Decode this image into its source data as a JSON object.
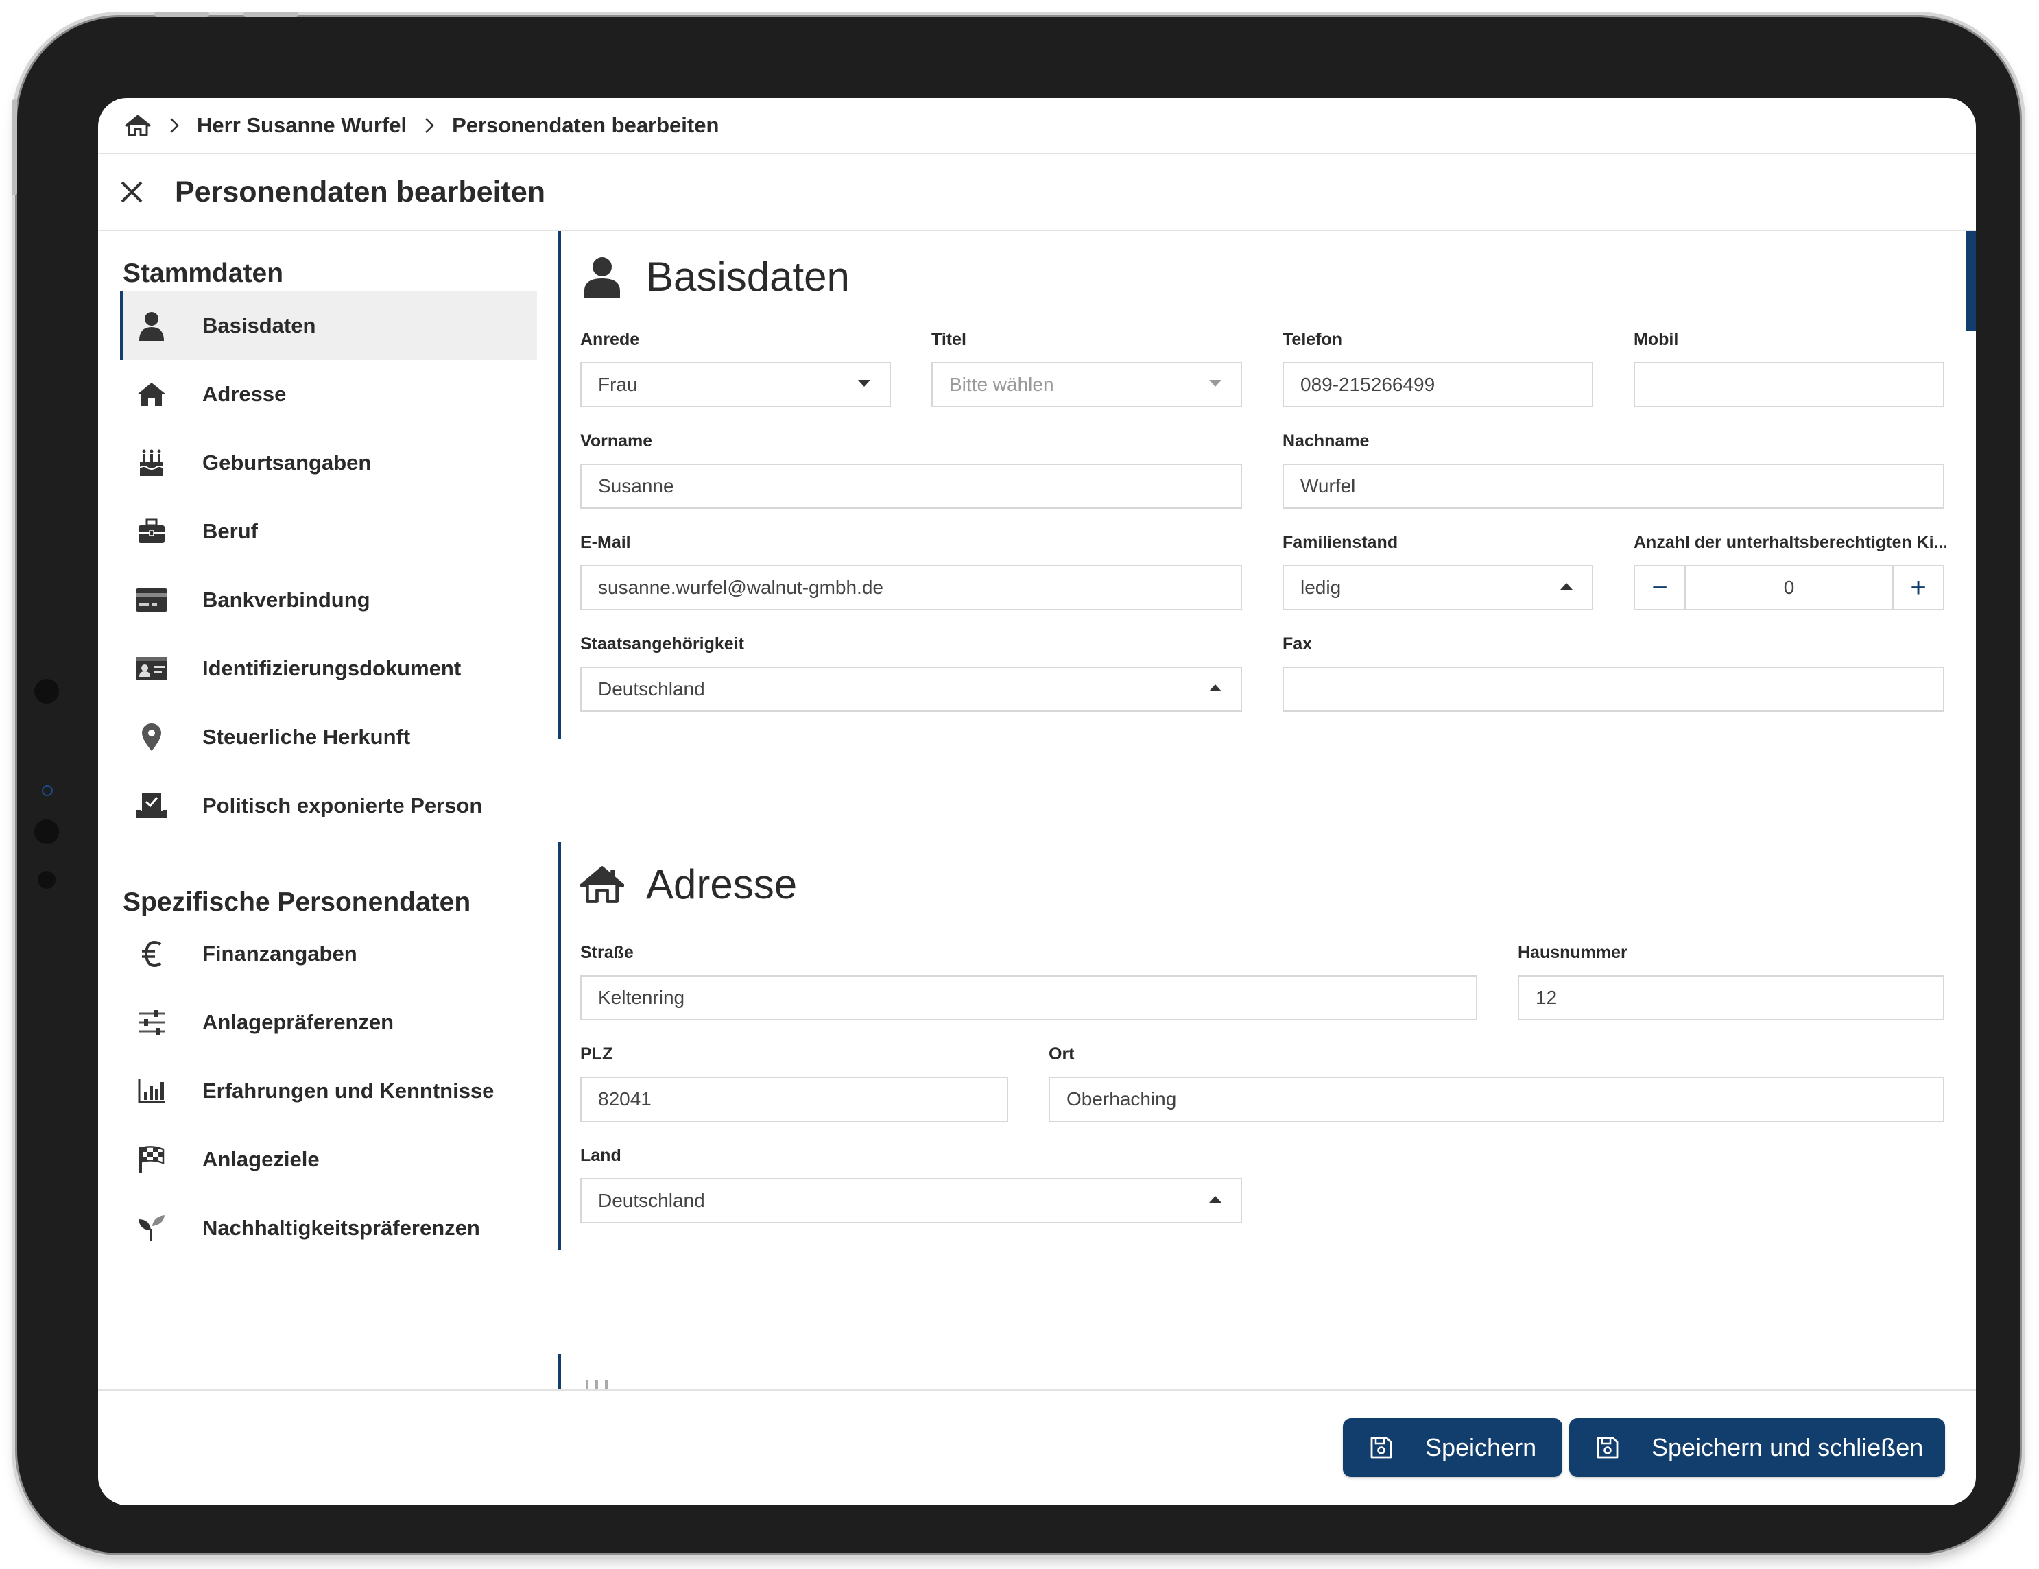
{
  "breadcrumb": {
    "items": [
      "Herr Susanne Wurfel",
      "Personendaten bearbeiten"
    ]
  },
  "page": {
    "title": "Personendaten bearbeiten"
  },
  "sidebar": {
    "groups": [
      {
        "title": "Stammdaten",
        "items": [
          {
            "label": "Basisdaten",
            "icon": "person-icon"
          },
          {
            "label": "Adresse",
            "icon": "home-icon"
          },
          {
            "label": "Geburtsangaben",
            "icon": "birthday-cake-icon"
          },
          {
            "label": "Beruf",
            "icon": "briefcase-icon"
          },
          {
            "label": "Bankverbindung",
            "icon": "credit-card-icon"
          },
          {
            "label": "Identifizierungsdokument",
            "icon": "id-card-icon"
          },
          {
            "label": "Steuerliche Herkunft",
            "icon": "map-pin-icon"
          },
          {
            "label": "Politisch exponierte Person",
            "icon": "ballot-box-icon"
          }
        ]
      },
      {
        "title": "Spezifische Personendaten",
        "items": [
          {
            "label": "Finanzangaben",
            "icon": "euro-icon"
          },
          {
            "label": "Anlagepräferenzen",
            "icon": "sliders-icon"
          },
          {
            "label": "Erfahrungen und Kenntnisse",
            "icon": "bar-chart-icon"
          },
          {
            "label": "Anlageziele",
            "icon": "checkered-flag-icon"
          },
          {
            "label": "Nachhaltigkeitspräferenzen",
            "icon": "seedling-icon"
          }
        ]
      }
    ],
    "active": "Basisdaten"
  },
  "basisdaten": {
    "title": "Basisdaten",
    "anrede": {
      "label": "Anrede",
      "value": "Frau"
    },
    "titel": {
      "label": "Titel",
      "placeholder": "Bitte wählen"
    },
    "telefon": {
      "label": "Telefon",
      "value": "089-215266499"
    },
    "mobil": {
      "label": "Mobil",
      "value": ""
    },
    "vorname": {
      "label": "Vorname",
      "value": "Susanne"
    },
    "nachname": {
      "label": "Nachname",
      "value": "Wurfel"
    },
    "email": {
      "label": "E-Mail",
      "value": "susanne.wurfel@walnut-gmbh.de"
    },
    "familienstand": {
      "label": "Familienstand",
      "value": "ledig"
    },
    "kinder": {
      "label": "Anzahl der unterhaltsberechtigten Ki...",
      "value": "0",
      "minus": "−",
      "plus": "+"
    },
    "staatsangehoerigkeit": {
      "label": "Staatsangehörigkeit",
      "value": "Deutschland"
    },
    "fax": {
      "label": "Fax",
      "value": ""
    }
  },
  "adresse": {
    "title": "Adresse",
    "strasse": {
      "label": "Straße",
      "value": "Keltenring"
    },
    "hausnummer": {
      "label": "Hausnummer",
      "value": "12"
    },
    "plz": {
      "label": "PLZ",
      "value": "82041"
    },
    "ort": {
      "label": "Ort",
      "value": "Oberhaching"
    },
    "land": {
      "label": "Land",
      "value": "Deutschland"
    }
  },
  "footer": {
    "save_label": "Speichern",
    "save_close_label": "Speichern und schließen"
  },
  "colors": {
    "accent": "#123e6d",
    "active_bg": "#efefef",
    "border": "#d7d7d7"
  }
}
